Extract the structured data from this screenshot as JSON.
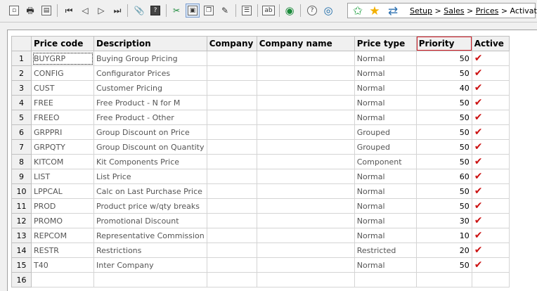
{
  "toolbar": {
    "icons": [
      "new-icon",
      "print-icon",
      "print-preview-icon",
      "first-record-icon",
      "previous-record-icon",
      "next-record-icon",
      "last-record-icon",
      "attachment-icon",
      "help-icon",
      "grid-tools-icon",
      "form-view-icon",
      "copy-view-icon",
      "edit-view-icon",
      "list-view-icon",
      "text-field-icon",
      "refresh-icon",
      "whats-this-icon",
      "search-icon"
    ]
  },
  "nav": {
    "breadcrumb": [
      "Setup",
      "Sales",
      "Prices"
    ],
    "current": "Activation",
    "separator": ">"
  },
  "grid": {
    "columns": [
      "Price code",
      "Description",
      "Company",
      "Company name",
      "Price type",
      "Priority",
      "Active"
    ],
    "rows": [
      {
        "n": "1",
        "code": "BUYGRP",
        "desc": "Buying Group Pricing",
        "company": "",
        "company_name": "",
        "type": "Normal",
        "priority": "50",
        "active": true
      },
      {
        "n": "2",
        "code": "CONFIG",
        "desc": "Configurator Prices",
        "company": "",
        "company_name": "",
        "type": "Normal",
        "priority": "50",
        "active": true
      },
      {
        "n": "3",
        "code": "CUST",
        "desc": "Customer Pricing",
        "company": "",
        "company_name": "",
        "type": "Normal",
        "priority": "40",
        "active": true
      },
      {
        "n": "4",
        "code": "FREE",
        "desc": "Free Product - N for M",
        "company": "",
        "company_name": "",
        "type": "Normal",
        "priority": "50",
        "active": true
      },
      {
        "n": "5",
        "code": "FREEO",
        "desc": "Free Product - Other",
        "company": "",
        "company_name": "",
        "type": "Normal",
        "priority": "50",
        "active": true
      },
      {
        "n": "6",
        "code": "GRPPRI",
        "desc": "Group Discount on Price",
        "company": "",
        "company_name": "",
        "type": "Grouped",
        "priority": "50",
        "active": true
      },
      {
        "n": "7",
        "code": "GRPQTY",
        "desc": "Group Discount on Quantity",
        "company": "",
        "company_name": "",
        "type": "Grouped",
        "priority": "50",
        "active": true
      },
      {
        "n": "8",
        "code": "KITCOM",
        "desc": "Kit Components Price",
        "company": "",
        "company_name": "",
        "type": "Component",
        "priority": "50",
        "active": true
      },
      {
        "n": "9",
        "code": "LIST",
        "desc": "List Price",
        "company": "",
        "company_name": "",
        "type": "Normal",
        "priority": "60",
        "active": true
      },
      {
        "n": "10",
        "code": "LPPCAL",
        "desc": "Calc on Last Purchase Price",
        "company": "",
        "company_name": "",
        "type": "Normal",
        "priority": "50",
        "active": true
      },
      {
        "n": "11",
        "code": "PROD",
        "desc": "Product price w/qty breaks",
        "company": "",
        "company_name": "",
        "type": "Normal",
        "priority": "50",
        "active": true
      },
      {
        "n": "12",
        "code": "PROMO",
        "desc": "Promotional Discount",
        "company": "",
        "company_name": "",
        "type": "Normal",
        "priority": "30",
        "active": true
      },
      {
        "n": "13",
        "code": "REPCOM",
        "desc": "Representative Commission",
        "company": "",
        "company_name": "",
        "type": "Normal",
        "priority": "10",
        "active": true
      },
      {
        "n": "14",
        "code": "RESTR",
        "desc": "Restrictions",
        "company": "",
        "company_name": "",
        "type": "Restricted",
        "priority": "20",
        "active": true
      },
      {
        "n": "15",
        "code": "T40",
        "desc": "Inter Company",
        "company": "",
        "company_name": "",
        "type": "Normal",
        "priority": "50",
        "active": true
      },
      {
        "n": "16",
        "code": "",
        "desc": "",
        "company": "",
        "company_name": "",
        "type": "",
        "priority": "",
        "active": false
      }
    ]
  },
  "colors": {
    "highlight": "#d4202a",
    "check": "#cc1111"
  }
}
